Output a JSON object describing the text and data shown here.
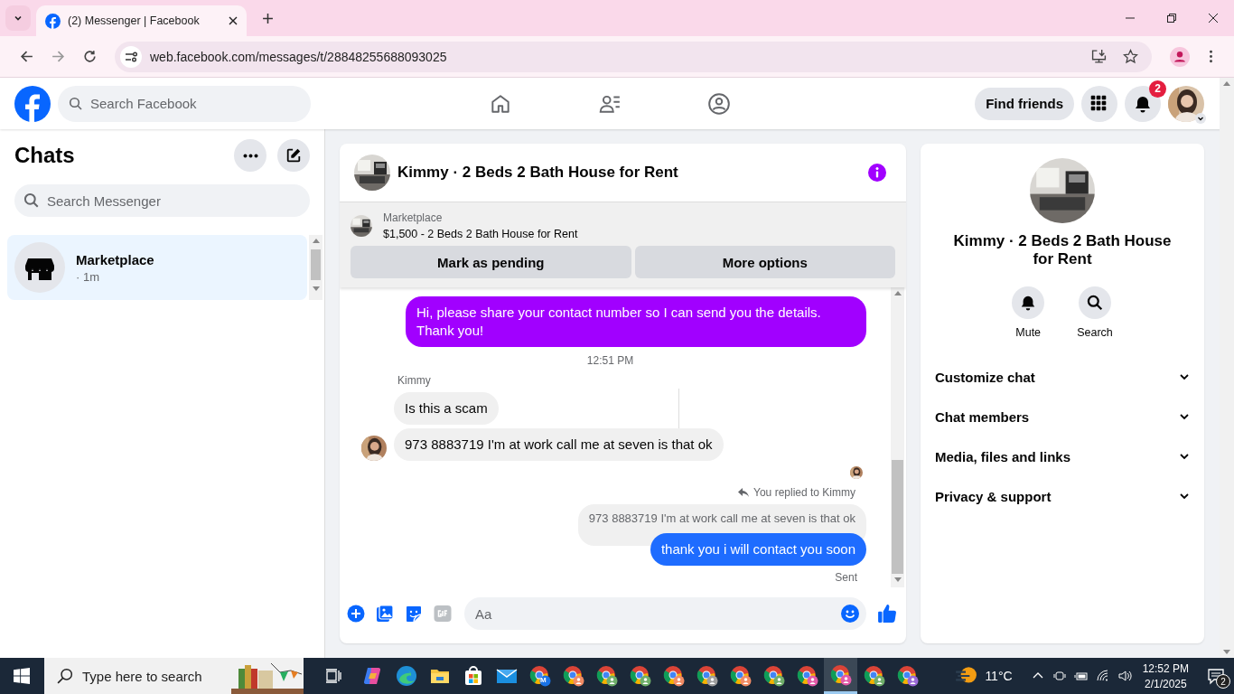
{
  "browser": {
    "tab_title": "(2) Messenger | Facebook",
    "url": "web.facebook.com/messages/t/28848255688093025"
  },
  "header": {
    "search_placeholder": "Search Facebook",
    "find_friends": "Find friends",
    "notification_count": "2"
  },
  "chats": {
    "title": "Chats",
    "search_placeholder": "Search Messenger",
    "items": [
      {
        "name": "Marketplace",
        "time": "· 1m",
        "selected": true
      }
    ]
  },
  "conversation": {
    "title": "Kimmy · 2 Beds 2 Bath House for Rent",
    "listing": {
      "source": "Marketplace",
      "title": "$1,500 - 2 Beds 2 Bath House for Rent"
    },
    "buttons": [
      "Mark as pending",
      "More options"
    ],
    "messages": [
      {
        "kind": "outgoing",
        "text": "Hi, please share your contact number so I can send you the details. Thank you!",
        "color": "#a100ff"
      },
      {
        "kind": "timestamp",
        "text": "12:51 PM"
      },
      {
        "kind": "sender",
        "text": "Kimmy"
      },
      {
        "kind": "incoming",
        "text": "Is this a scam",
        "avatar": false
      },
      {
        "kind": "incoming",
        "text": "973 8883719 I'm at work call me at seven is that ok",
        "avatar": true
      },
      {
        "kind": "seen"
      },
      {
        "kind": "reply_label",
        "text": "You replied to Kimmy"
      },
      {
        "kind": "quoted",
        "text": "973 8883719 I'm at work call me at seven is that ok"
      },
      {
        "kind": "outgoing",
        "text": "thank you i will contact you soon",
        "color": "#1e6cff"
      },
      {
        "kind": "status",
        "text": "Sent"
      }
    ],
    "composer_placeholder": "Aa"
  },
  "details": {
    "name": "Kimmy · 2 Beds 2 Bath House for Rent",
    "actions": [
      {
        "kind": "mute",
        "label": "Mute"
      },
      {
        "kind": "search",
        "label": "Search"
      }
    ],
    "sections": [
      {
        "label": "Customize chat",
        "expanded": false
      },
      {
        "label": "Chat members",
        "expanded": false
      },
      {
        "label": "Media, files and links",
        "expanded": false
      },
      {
        "label": "Privacy & support",
        "expanded": false
      }
    ]
  },
  "taskbar": {
    "search_placeholder": "Type here to search",
    "apps": [
      {
        "kind": "copilot",
        "selected": false
      },
      {
        "kind": "edge",
        "selected": false
      },
      {
        "kind": "files",
        "selected": false
      },
      {
        "kind": "store",
        "selected": false
      },
      {
        "kind": "mail",
        "selected": false
      },
      {
        "kind": "chrome",
        "color": "#1a73e8",
        "badge": "M",
        "selected": false
      },
      {
        "kind": "chrome",
        "color": "#f28b64",
        "selected": false
      },
      {
        "kind": "chrome",
        "color": "#6fae6a",
        "selected": false
      },
      {
        "kind": "chrome",
        "color": "#6fae6a",
        "selected": false
      },
      {
        "kind": "chrome",
        "color": "#f28b64",
        "selected": false
      },
      {
        "kind": "chrome",
        "color": "#9e9e9e",
        "selected": false
      },
      {
        "kind": "chrome",
        "color": "#f28b64",
        "selected": false
      },
      {
        "kind": "chrome",
        "color": "#6fae6a",
        "selected": false
      },
      {
        "kind": "chrome",
        "color": "#e25aa8",
        "selected": false
      },
      {
        "kind": "chrome",
        "color": "#e25aa8",
        "selected": true
      },
      {
        "kind": "chrome",
        "color": "#6fae6a",
        "selected": false
      },
      {
        "kind": "chrome",
        "color": "#9b6ad6",
        "selected": false
      }
    ],
    "weather": "11°C",
    "time": "12:52 PM",
    "date": "2/1/2025",
    "notification_count": "2"
  }
}
